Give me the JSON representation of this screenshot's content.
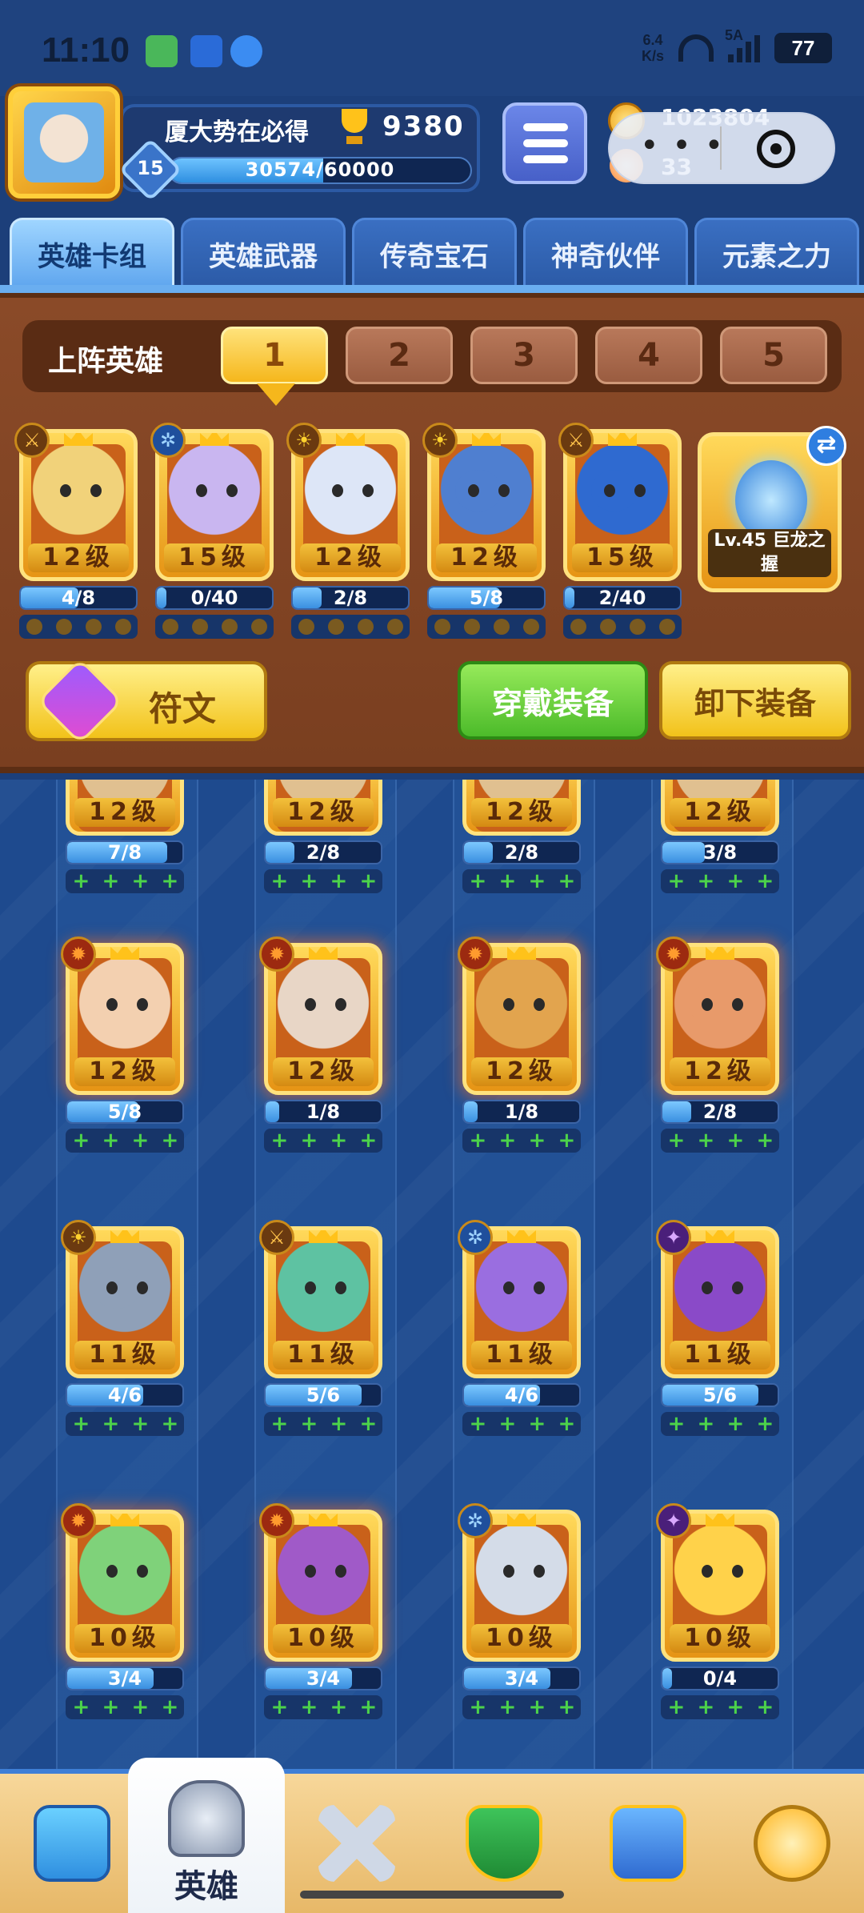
{
  "status": {
    "time": "11:10",
    "net_speed_top": "6.4",
    "net_speed_bottom": "K/s",
    "signal_label": "5A",
    "battery": "77"
  },
  "player": {
    "name": "厦大势在必得",
    "trophies": "9380",
    "level": "15",
    "xp": "30574/60000",
    "xp_fraction": 0.51
  },
  "currency": {
    "coins": "1023804",
    "gems": "33"
  },
  "tabs": [
    "英雄卡组",
    "英雄武器",
    "传奇宝石",
    "神奇伙伴",
    "元素之力"
  ],
  "team": {
    "label": "上阵英雄",
    "slots": [
      "1",
      "2",
      "3",
      "4",
      "5"
    ],
    "active_slot": 0
  },
  "lineup": [
    {
      "element": "sword",
      "level": "12级",
      "progress": "4/8",
      "fraction": 0.5,
      "tint": "#f1d27a"
    },
    {
      "element": "gear",
      "level": "15级",
      "progress": "0/40",
      "fraction": 0.0,
      "tint": "#c9b6f0"
    },
    {
      "element": "sun",
      "level": "12级",
      "progress": "2/8",
      "fraction": 0.25,
      "tint": "#dde6f7"
    },
    {
      "element": "sun",
      "level": "12级",
      "progress": "5/8",
      "fraction": 0.62,
      "tint": "#4f7fd0"
    },
    {
      "element": "sword",
      "level": "15级",
      "progress": "2/40",
      "fraction": 0.05,
      "tint": "#2f6ad0"
    }
  ],
  "weapon": {
    "label": "Lv.45 巨龙之握"
  },
  "buttons": {
    "rune": "符文",
    "equip": "穿戴装备",
    "unequip": "卸下装备"
  },
  "cards_row0": [
    {
      "level": "12级",
      "progress": "7/8",
      "fraction": 0.87
    },
    {
      "level": "12级",
      "progress": "2/8",
      "fraction": 0.25
    },
    {
      "level": "12级",
      "progress": "2/8",
      "fraction": 0.25
    },
    {
      "level": "12级",
      "progress": "3/8",
      "fraction": 0.37
    }
  ],
  "cards_row1": [
    {
      "element": "fire",
      "level": "12级",
      "progress": "5/8",
      "fraction": 0.62,
      "tint": "#f3d0b0"
    },
    {
      "element": "fire",
      "level": "12级",
      "progress": "1/8",
      "fraction": 0.12,
      "tint": "#e8d6c6"
    },
    {
      "element": "fire",
      "level": "12级",
      "progress": "1/8",
      "fraction": 0.12,
      "tint": "#e2a44e"
    },
    {
      "element": "fire",
      "level": "12级",
      "progress": "2/8",
      "fraction": 0.25,
      "tint": "#e89a6a"
    }
  ],
  "cards_row2": [
    {
      "element": "sun",
      "level": "11级",
      "progress": "4/6",
      "fraction": 0.66,
      "tint": "#8fa0b8"
    },
    {
      "element": "sword",
      "level": "11级",
      "progress": "5/6",
      "fraction": 0.83,
      "tint": "#5ec2a2"
    },
    {
      "element": "gear",
      "level": "11级",
      "progress": "4/6",
      "fraction": 0.66,
      "tint": "#9a6ee0"
    },
    {
      "element": "star",
      "level": "11级",
      "progress": "5/6",
      "fraction": 0.83,
      "tint": "#8a4ac8"
    }
  ],
  "cards_row3": [
    {
      "element": "fire",
      "level": "10级",
      "progress": "3/4",
      "fraction": 0.75,
      "tint": "#7fd27a"
    },
    {
      "element": "fire",
      "level": "10级",
      "progress": "3/4",
      "fraction": 0.75,
      "tint": "#a05ac8"
    },
    {
      "element": "gear",
      "level": "10级",
      "progress": "3/4",
      "fraction": 0.75,
      "tint": "#d4dce8"
    },
    {
      "element": "star",
      "level": "10级",
      "progress": "0/4",
      "fraction": 0.0,
      "tint": "#ffd24a"
    }
  ],
  "nav": {
    "active_label": "英雄"
  }
}
